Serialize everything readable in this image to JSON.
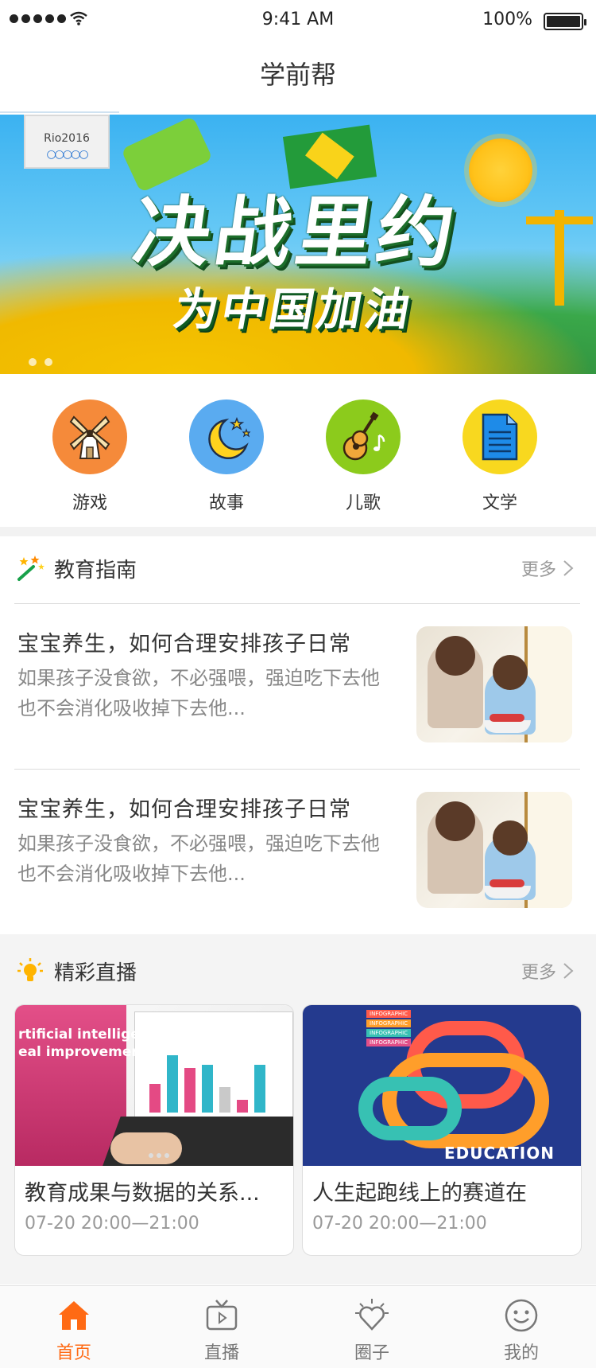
{
  "status_bar": {
    "time": "9:41 AM",
    "battery_percent": "100%"
  },
  "nav": {
    "title": "学前帮"
  },
  "banner": {
    "headline": "决战里约",
    "subline": "为中国加油",
    "badge": "Rio2016"
  },
  "categories": [
    {
      "label": "游戏",
      "icon": "windmill-icon",
      "color": "#f58a3a"
    },
    {
      "label": "故事",
      "icon": "moon-stars-icon",
      "color": "#5aabf0"
    },
    {
      "label": "儿歌",
      "icon": "guitar-icon",
      "color": "#8ccb1c"
    },
    {
      "label": "文学",
      "icon": "document-icon",
      "color": "#f8d81f"
    }
  ],
  "guide": {
    "title": "教育指南",
    "more": "更多",
    "articles": [
      {
        "title": "宝宝养生，如何合理安排孩子日常",
        "desc": "如果孩子没食欲，不必强喂，强迫吃下去他也不会消化吸收掉下去他..."
      },
      {
        "title": "宝宝养生，如何合理安排孩子日常",
        "desc": "如果孩子没食欲，不必强喂，强迫吃下去他也不会消化吸收掉下去他..."
      }
    ]
  },
  "live": {
    "title": "精彩直播",
    "more": "更多",
    "cards": [
      {
        "title": "教育成果与数据的关系...",
        "time": "07-20  20:00—21:00",
        "image_text": "rtificial intelligence\neal improvements"
      },
      {
        "title": "人生起跑线上的赛道在",
        "time": "07-20  20:00—21:00",
        "image_text": "EDUCATION"
      }
    ]
  },
  "tabs": [
    {
      "label": "首页",
      "icon": "home-icon",
      "active": true
    },
    {
      "label": "直播",
      "icon": "tv-icon",
      "active": false
    },
    {
      "label": "圈子",
      "icon": "heart-sun-icon",
      "active": false
    },
    {
      "label": "我的",
      "icon": "smiley-icon",
      "active": false
    }
  ],
  "colors": {
    "accent": "#ff6a14",
    "divider": "#f2f2f2"
  }
}
